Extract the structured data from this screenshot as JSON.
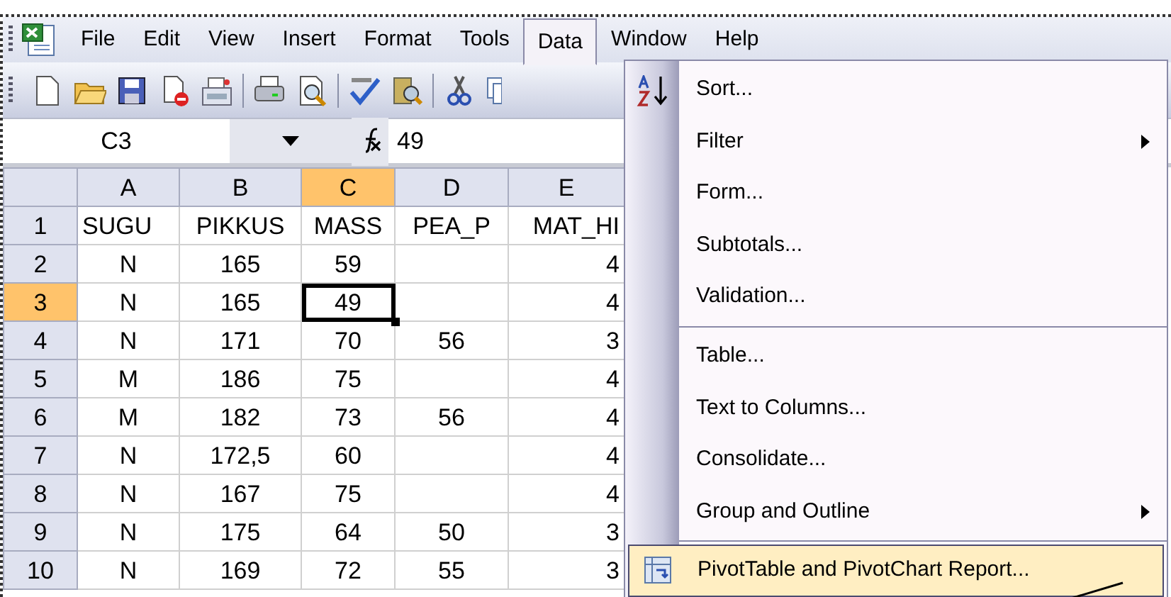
{
  "menu_bar": {
    "items": [
      {
        "label": "File",
        "selected": false
      },
      {
        "label": "Edit",
        "selected": false
      },
      {
        "label": "View",
        "selected": false
      },
      {
        "label": "Insert",
        "selected": false
      },
      {
        "label": "Format",
        "selected": false
      },
      {
        "label": "Tools",
        "selected": false
      },
      {
        "label": "Data",
        "selected": true
      },
      {
        "label": "Window",
        "selected": false
      },
      {
        "label": "Help",
        "selected": false
      }
    ]
  },
  "formula_bar": {
    "name_box": "C3",
    "value": "49"
  },
  "sheet": {
    "columns": [
      {
        "label": "A",
        "selected": false
      },
      {
        "label": "B",
        "selected": false
      },
      {
        "label": "C",
        "selected": true
      },
      {
        "label": "D",
        "selected": false
      },
      {
        "label": "E",
        "selected": false
      }
    ],
    "rows": [
      {
        "label": "1",
        "selected": false,
        "cells": [
          {
            "text": "SUGU",
            "active": false
          },
          {
            "text": "PIKKUS",
            "active": false
          },
          {
            "text": "MASS",
            "active": false
          },
          {
            "text": "PEA_P",
            "active": false
          },
          {
            "text": "MAT_HI",
            "active": false
          }
        ]
      },
      {
        "label": "2",
        "selected": false,
        "cells": [
          {
            "text": "N",
            "active": false
          },
          {
            "text": "165",
            "active": false
          },
          {
            "text": "59",
            "active": false
          },
          {
            "active": false
          },
          {
            "text": "4",
            "active": false
          }
        ]
      },
      {
        "label": "3",
        "selected": true,
        "cells": [
          {
            "text": "N",
            "active": false
          },
          {
            "text": "165",
            "active": false
          },
          {
            "text": "49",
            "active": true
          },
          {
            "active": false
          },
          {
            "text": "4",
            "active": false
          }
        ]
      },
      {
        "label": "4",
        "selected": false,
        "cells": [
          {
            "text": "N",
            "active": false
          },
          {
            "text": "171",
            "active": false
          },
          {
            "text": "70",
            "active": false
          },
          {
            "text": "56",
            "active": false
          },
          {
            "text": "3",
            "active": false
          }
        ]
      },
      {
        "label": "5",
        "selected": false,
        "cells": [
          {
            "text": "M",
            "active": false
          },
          {
            "text": "186",
            "active": false
          },
          {
            "text": "75",
            "active": false
          },
          {
            "active": false
          },
          {
            "text": "4",
            "active": false
          }
        ]
      },
      {
        "label": "6",
        "selected": false,
        "cells": [
          {
            "text": "M",
            "active": false
          },
          {
            "text": "182",
            "active": false
          },
          {
            "text": "73",
            "active": false
          },
          {
            "text": "56",
            "active": false
          },
          {
            "text": "4",
            "active": false
          }
        ]
      },
      {
        "label": "7",
        "selected": false,
        "cells": [
          {
            "text": "N",
            "active": false
          },
          {
            "text": "172,5",
            "active": false
          },
          {
            "text": "60",
            "active": false
          },
          {
            "active": false
          },
          {
            "text": "4",
            "active": false
          }
        ]
      },
      {
        "label": "8",
        "selected": false,
        "cells": [
          {
            "text": "N",
            "active": false
          },
          {
            "text": "167",
            "active": false
          },
          {
            "text": "75",
            "active": false
          },
          {
            "active": false
          },
          {
            "text": "4",
            "active": false
          }
        ]
      },
      {
        "label": "9",
        "selected": false,
        "cells": [
          {
            "text": "N",
            "active": false
          },
          {
            "text": "175",
            "active": false
          },
          {
            "text": "64",
            "active": false
          },
          {
            "text": "50",
            "active": false
          },
          {
            "text": "3",
            "active": false
          }
        ]
      },
      {
        "label": "10",
        "selected": false,
        "cells": [
          {
            "text": "N",
            "active": false
          },
          {
            "text": "169",
            "active": false
          },
          {
            "text": "72",
            "active": false
          },
          {
            "text": "55",
            "active": false
          },
          {
            "text": "3",
            "active": false
          }
        ]
      }
    ]
  },
  "data_menu": {
    "items": [
      {
        "kind": "item",
        "label": "Sort...",
        "submenu": false,
        "highlighted": false
      },
      {
        "kind": "item",
        "label": "Filter",
        "submenu": true,
        "highlighted": false
      },
      {
        "kind": "item",
        "label": "Form...",
        "submenu": false,
        "highlighted": false
      },
      {
        "kind": "item",
        "label": "Subtotals...",
        "submenu": false,
        "highlighted": false
      },
      {
        "kind": "item",
        "label": "Validation...",
        "submenu": false,
        "highlighted": false
      },
      {
        "kind": "separator"
      },
      {
        "kind": "item",
        "label": "Table...",
        "submenu": false,
        "highlighted": false
      },
      {
        "kind": "item",
        "label": "Text to Columns...",
        "submenu": false,
        "highlighted": false
      },
      {
        "kind": "item",
        "label": "Consolidate...",
        "submenu": false,
        "highlighted": false
      },
      {
        "kind": "item",
        "label": "Group and Outline",
        "submenu": true,
        "highlighted": false
      },
      {
        "kind": "separator"
      },
      {
        "kind": "item",
        "label": "PivotTable and PivotChart Report...",
        "submenu": false,
        "highlighted": true
      }
    ]
  }
}
